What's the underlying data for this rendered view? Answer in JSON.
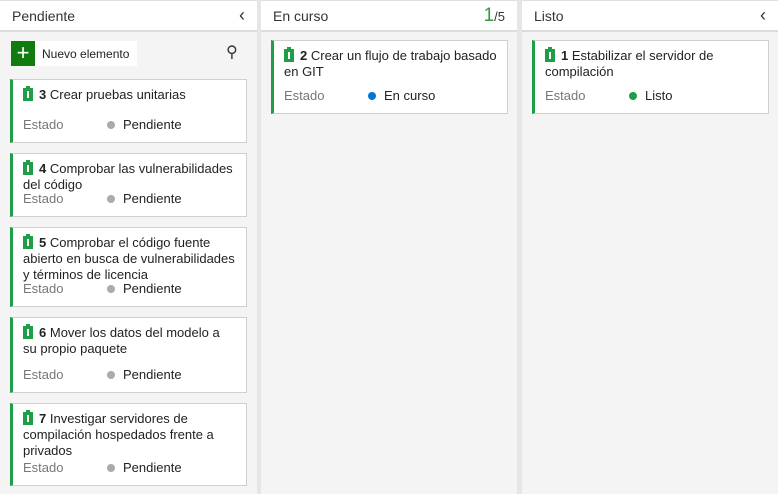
{
  "columns": [
    {
      "title": "Pendiente",
      "new_item": "Nuevo elemento",
      "cards": [
        {
          "id": "3",
          "title": "Crear pruebas unitarias",
          "state_label": "Estado",
          "state": "Pendiente"
        },
        {
          "id": "4",
          "title": "Comprobar las vulnerabilidades del código",
          "state_label": "Estado",
          "state": "Pendiente"
        },
        {
          "id": "5",
          "title": "Comprobar el código fuente abierto en busca de vulnerabilidades y términos de licencia",
          "state_label": "Estado",
          "state": "Pendiente"
        },
        {
          "id": "6",
          "title": "Mover los datos del modelo a su propio paquete",
          "state_label": "Estado",
          "state": "Pendiente"
        },
        {
          "id": "7",
          "title": "Investigar servidores de compilación hospedados frente a privados",
          "state_label": "Estado",
          "state": "Pendiente"
        }
      ]
    },
    {
      "title": "En curso",
      "wip_current": "1",
      "wip_limit": "/5",
      "cards": [
        {
          "id": "2",
          "title": "Crear un flujo de trabajo basado en GIT",
          "state_label": "Estado",
          "state": "En curso"
        }
      ]
    },
    {
      "title": "Listo",
      "cards": [
        {
          "id": "1",
          "title": "Estabilizar el servidor de compilación",
          "state_label": "Estado",
          "state": "Listo"
        }
      ]
    }
  ],
  "colors": {
    "pending": "#aaaaaa",
    "in_progress": "#0078d4",
    "done": "#1e9e46"
  }
}
